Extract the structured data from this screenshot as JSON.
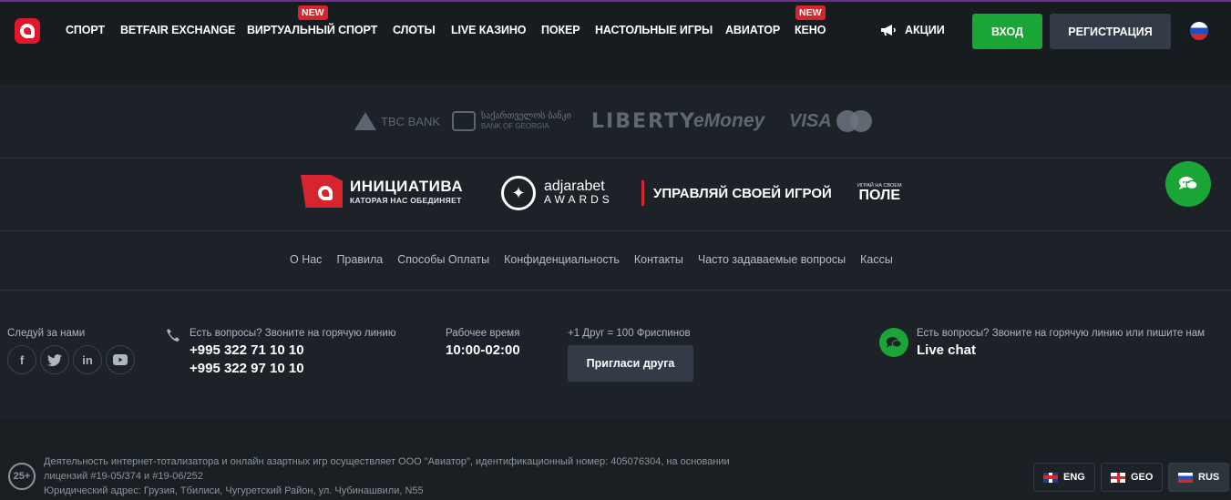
{
  "nav": {
    "items": [
      "СПОРТ",
      "BETFAIR EXCHANGE",
      "ВИРТУАЛЬНЫЙ СПОРТ",
      "СЛОТЫ",
      "LIVE КАЗИНО",
      "ПОКЕР",
      "НАСТОЛЬНЫЕ ИГРЫ",
      "АВИАТОР",
      "КЕНО"
    ],
    "new_badge": "NEW",
    "promo_label": "АКЦИИ",
    "login_label": "ВХОД",
    "register_label": "РЕГИСТРАЦИЯ"
  },
  "payments": {
    "tbc": "TBC BANK",
    "bog_geo": "საქართველოს ბანკი",
    "bog_en": "BANK OF GEORGIA",
    "liberty": "LIBERTY",
    "emoney": "eMoney",
    "visa": "VISA"
  },
  "partners": {
    "initiative_title": "ИНИЦИАТИВА",
    "initiative_sub": "КАТОРАЯ НАС ОБЕДИНЯЕТ",
    "awards_title": "adjarabet",
    "awards_sub": "AWARDS",
    "manage": "УПРАВЛЯЙ СВОЕЙ ИГРОЙ",
    "field_small": "ИГРАЙ НА СВОЕМ",
    "field_big": "ПОЛЕ"
  },
  "footer_links": [
    "О Нас",
    "Правила",
    "Способы Оплаты",
    "Конфиденциальность",
    "Контакты",
    "Часто задаваемые вопросы",
    "Кассы"
  ],
  "info": {
    "follow_label": "Следуй за нами",
    "hotline_label": "Есть вопросы? Звоните на горячую линию",
    "phone1": "+995 322 71 10 10",
    "phone2": "+995 322 97 10 10",
    "hours_label": "Рабочее время",
    "hours": "10:00-02:00",
    "friend_label": "+1 Друг = 100 Фриспинов",
    "invite_button": "Пригласи друга",
    "live_label": "Есть вопросы? Звоните на горячую линию или пишите нам",
    "live_chat": "Live chat"
  },
  "legal": {
    "age": "25+",
    "line1": "Деятельность интернет-тотализатора и онлайн азартных игр осуществляет ООО \"Авиатор\", идентификационный номер: 405076304, на основании",
    "line2": "лицензий #19-05/374 и #19-06/252",
    "line3": "Юридический адрес: Грузия, Тбилиси, Чугуретский Район, ул. Чубинашвили, N55"
  },
  "languages": [
    "ENG",
    "GEO",
    "RUS"
  ],
  "colors": {
    "accent_green": "#1aa537",
    "brand_red": "#e3162b",
    "bg": "#1c2227"
  }
}
